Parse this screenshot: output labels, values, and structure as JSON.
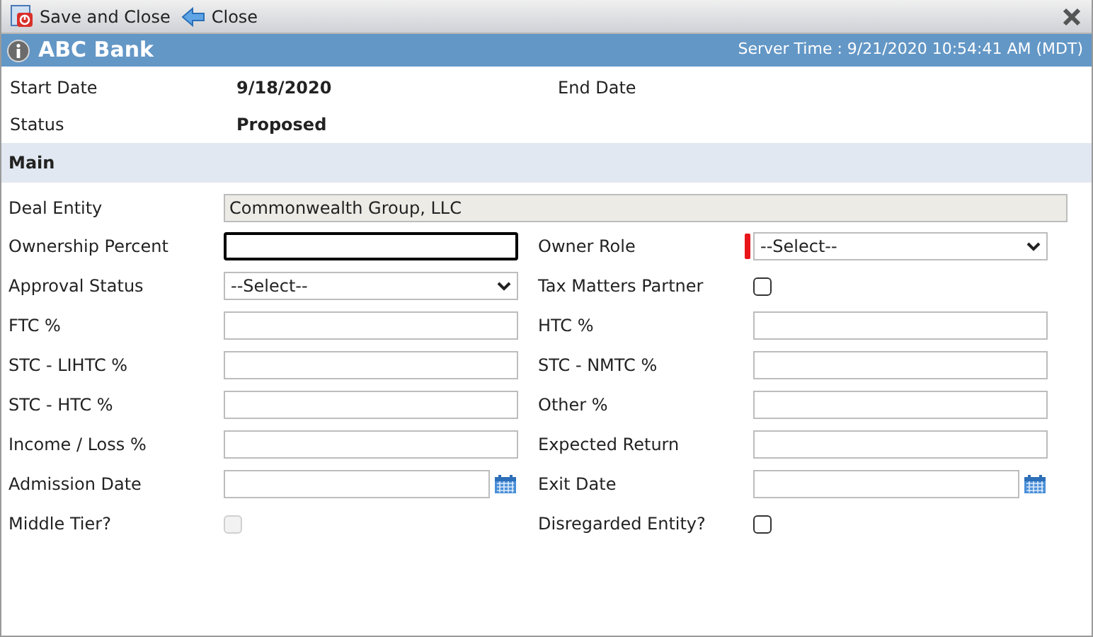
{
  "toolbar": {
    "buttons": [
      {
        "kind": "save",
        "label": "Save and Close"
      },
      {
        "kind": "back",
        "label": "Close"
      }
    ]
  },
  "header": {
    "title": "ABC Bank",
    "server_time": "Server Time : 9/21/2020 10:54:41 AM (MDT)"
  },
  "summary": [
    {
      "label": "Start Date",
      "value": "9/18/2020"
    },
    {
      "label": "End Date"
    },
    {
      "label": "Status",
      "value": "Proposed"
    }
  ],
  "section": {
    "title": "Main"
  },
  "deal_entity": {
    "label": "Deal Entity",
    "value": "Commonwealth Group, LLC"
  },
  "fields": [
    {
      "label": "Ownership Percent",
      "kind": "text",
      "focused": true
    },
    {
      "label": "Owner Role",
      "kind": "select",
      "value": "--Select--",
      "required": true
    },
    {
      "label": "Approval Status",
      "kind": "select",
      "value": "--Select--",
      "required": false
    },
    {
      "label": "Tax Matters Partner",
      "kind": "checkbox",
      "checked": false,
      "disabled": false
    },
    {
      "label": "FTC %",
      "kind": "text",
      "focused": false
    },
    {
      "label": "HTC %",
      "kind": "text",
      "focused": false
    },
    {
      "label": "STC - LIHTC %",
      "kind": "text",
      "focused": false
    },
    {
      "label": "STC - NMTC %",
      "kind": "text",
      "focused": false
    },
    {
      "label": "STC - HTC %",
      "kind": "text",
      "focused": false
    },
    {
      "label": "Other %",
      "kind": "text",
      "focused": false
    },
    {
      "label": "Income / Loss %",
      "kind": "text",
      "focused": false
    },
    {
      "label": "Expected Return",
      "kind": "text",
      "focused": false
    },
    {
      "label": "Admission Date",
      "kind": "date"
    },
    {
      "label": "Exit Date",
      "kind": "date"
    },
    {
      "label": "Middle Tier?",
      "kind": "checkbox",
      "checked": false,
      "disabled": true
    },
    {
      "label": "Disregarded Entity?",
      "kind": "checkbox",
      "checked": false,
      "disabled": false
    }
  ]
}
